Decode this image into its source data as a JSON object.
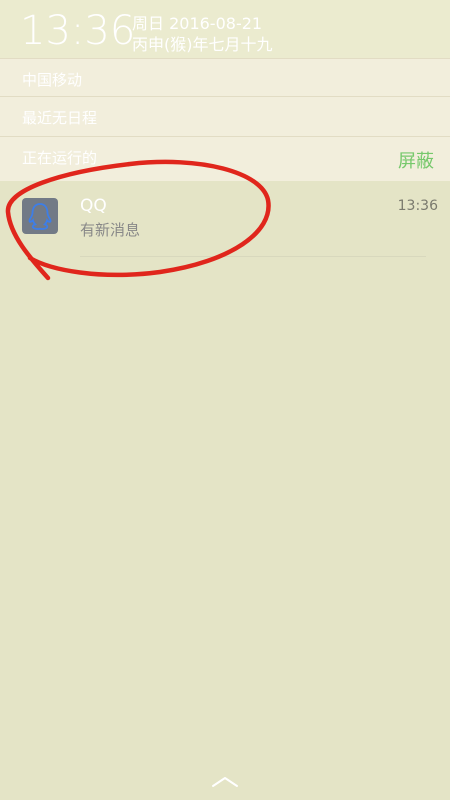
{
  "header": {
    "time": "13:36",
    "weekday_date": "周日 2016-08-21",
    "lunar_date": "丙申(猴)年七月十九"
  },
  "panel": {
    "carrier": "中国移动",
    "schedule": "最近无日程",
    "running": "正在运行的",
    "block_button": "屏蔽"
  },
  "notification": {
    "app_name": "QQ",
    "message": "有新消息",
    "time": "13:36",
    "icon": "qq-penguin-icon"
  },
  "annotation_color": "#e0261c",
  "accent_color": "#76c86b"
}
